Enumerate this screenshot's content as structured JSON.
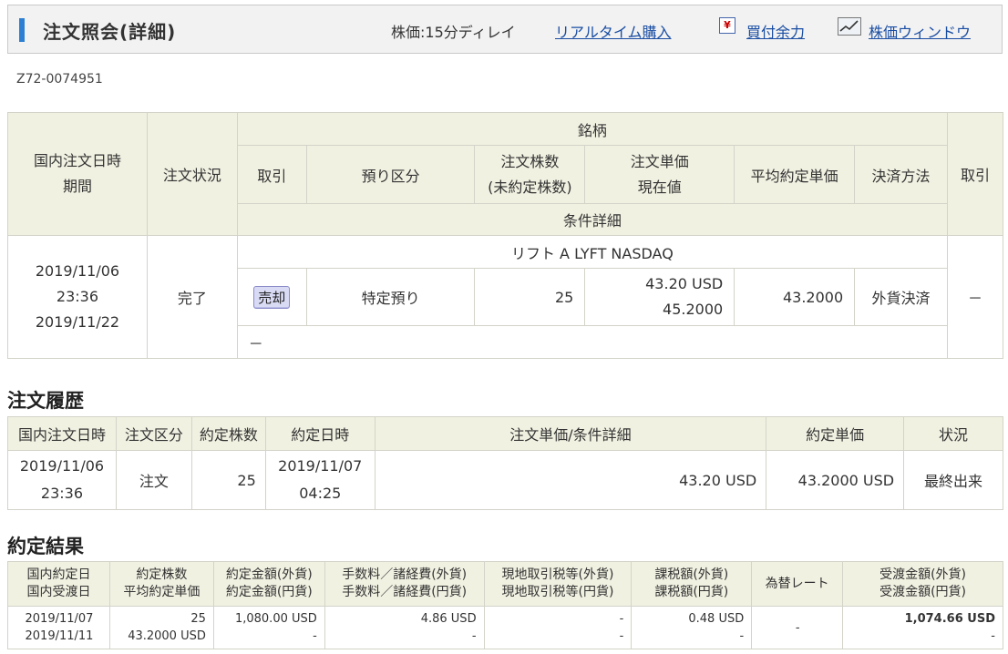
{
  "header": {
    "title": "注文照会(詳細)",
    "delay_text": "株価:15分ディレイ",
    "realtime_link": "リアルタイム購入",
    "buying_power_link": "買付余力",
    "price_window_link": "株価ウィンドウ"
  },
  "order_number": "Z72-0074951",
  "order_table": {
    "headers": {
      "order_datetime": "国内注文日時",
      "period": "期間",
      "status": "注文状況",
      "security": "銘柄",
      "trade": "取引",
      "custody": "預り区分",
      "qty": "注文株数",
      "unfilled_qty": "(未約定株数)",
      "unit_price": "注文単価",
      "current_price": "現在値",
      "avg_price": "平均約定単価",
      "settlement": "決済方法",
      "condition": "条件詳細",
      "cancel": "取引"
    },
    "row": {
      "date": "2019/11/06",
      "time": "23:36",
      "period": "2019/11/22",
      "status": "完了",
      "security_name": "リフト A LYFT NASDAQ",
      "trade": "売却",
      "custody": "特定預り",
      "qty": "25",
      "unit_price": "43.20 USD",
      "current_price": "45.2000",
      "avg_price": "43.2000",
      "settlement": "外貨決済",
      "condition": "－",
      "cancel": "－"
    }
  },
  "history": {
    "title": "注文履歴",
    "headers": [
      "国内注文日時",
      "注文区分",
      "約定株数",
      "約定日時",
      "注文単価/条件詳細",
      "約定単価",
      "状況"
    ],
    "row": {
      "order_date": "2019/11/06",
      "order_time": "23:36",
      "type": "注文",
      "qty": "25",
      "exec_date": "2019/11/07",
      "exec_time": "04:25",
      "price": "43.20 USD",
      "exec_price": "43.2000 USD",
      "status": "最終出来"
    }
  },
  "results": {
    "title": "約定結果",
    "headers": [
      [
        "国内約定日",
        "国内受渡日"
      ],
      [
        "約定株数",
        "平均約定単価"
      ],
      [
        "約定金額(外貨)",
        "約定金額(円貨)"
      ],
      [
        "手数料／諸経費(外貨)",
        "手数料／諸経費(円貨)"
      ],
      [
        "現地取引税等(外貨)",
        "現地取引税等(円貨)"
      ],
      [
        "課税額(外貨)",
        "課税額(円貨)"
      ],
      [
        "為替レート"
      ],
      [
        "受渡金額(外貨)",
        "受渡金額(円貨)"
      ]
    ],
    "row": {
      "exec_date": "2019/11/07",
      "settle_date": "2019/11/11",
      "qty": "25",
      "avg_price": "43.2000 USD",
      "amount_fx": "1,080.00 USD",
      "amount_jpy": "-",
      "fee_fx": "4.86 USD",
      "fee_jpy": "-",
      "tax_local_fx": "-",
      "tax_local_jpy": "-",
      "taxable_fx": "0.48 USD",
      "taxable_jpy": "-",
      "fx_rate": "-",
      "delivery_fx": "1,074.66 USD",
      "delivery_jpy": "-"
    }
  }
}
